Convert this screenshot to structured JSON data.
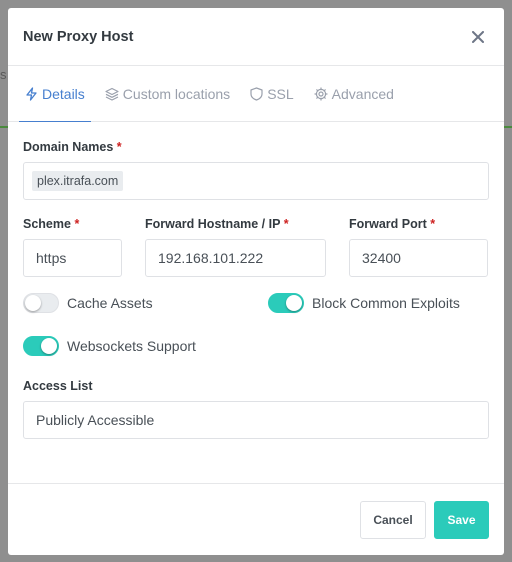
{
  "modal": {
    "title": "New Proxy Host",
    "close_icon": "close-icon"
  },
  "tabs": [
    {
      "label": "Details",
      "icon": "bolt-icon",
      "active": true
    },
    {
      "label": "Custom locations",
      "icon": "layers-icon",
      "active": false
    },
    {
      "label": "SSL",
      "icon": "shield-icon",
      "active": false
    },
    {
      "label": "Advanced",
      "icon": "gear-icon",
      "active": false
    }
  ],
  "form": {
    "domain_names": {
      "label": "Domain Names",
      "required_mark": "*",
      "tags": [
        "plex.itrafa.com"
      ]
    },
    "scheme": {
      "label": "Scheme",
      "required_mark": "*",
      "value": "https"
    },
    "forward_host": {
      "label": "Forward Hostname / IP",
      "required_mark": "*",
      "value": "192.168.101.222"
    },
    "forward_port": {
      "label": "Forward Port",
      "required_mark": "*",
      "value": "32400"
    },
    "toggles": {
      "cache_assets": {
        "label": "Cache Assets",
        "on": false
      },
      "block_exploits": {
        "label": "Block Common Exploits",
        "on": true
      },
      "websockets": {
        "label": "Websockets Support",
        "on": true
      }
    },
    "access_list": {
      "label": "Access List",
      "value": "Publicly Accessible"
    }
  },
  "footer": {
    "cancel_label": "Cancel",
    "save_label": "Save"
  },
  "colors": {
    "accent": "#467fcf",
    "toggle_on": "#2bcbba",
    "save_button": "#2bcbba",
    "required": "#cd201f"
  }
}
